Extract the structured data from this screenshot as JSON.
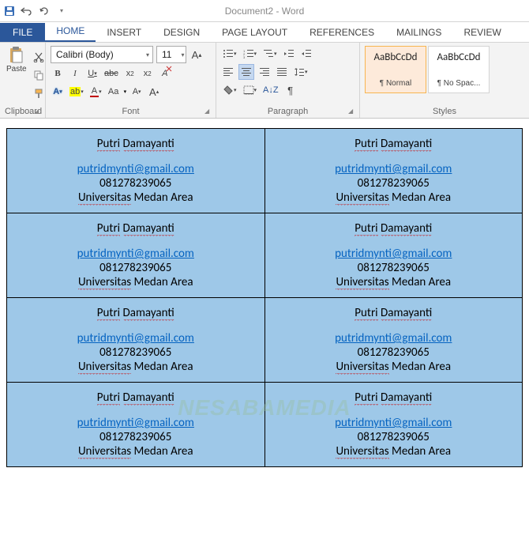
{
  "title": "Document2 - Word",
  "tabs": {
    "file": "FILE",
    "home": "HOME",
    "insert": "INSERT",
    "design": "DESIGN",
    "layout": "PAGE LAYOUT",
    "references": "REFERENCES",
    "mailings": "MAILINGS",
    "review": "REVIEW"
  },
  "ribbon": {
    "clipboard": {
      "label": "Clipboard",
      "paste": "Paste"
    },
    "font": {
      "label": "Font",
      "name": "Calibri (Body)",
      "size": "11",
      "bold": "B",
      "italic": "I",
      "underline": "U",
      "strike": "abc",
      "sub": "x₂",
      "sup": "x²",
      "fontcolor": "A",
      "highlight": "ab",
      "clear": "A",
      "case": "Aa",
      "grow": "A",
      "shrink": "A"
    },
    "paragraph": {
      "label": "Paragraph"
    },
    "styles": {
      "label": "Styles",
      "items": [
        {
          "sample": "AaBbCcDd",
          "name": "¶ Normal"
        },
        {
          "sample": "AaBbCcDd",
          "name": "¶ No Spac..."
        }
      ]
    }
  },
  "watermark": "NESABAMEDIA",
  "label": {
    "name": "Putri Damayanti",
    "name_p1": "Putri",
    "name_p2": "Damayanti",
    "email": "putridmynti@gmail.com",
    "phone": "081278239065",
    "univ": "Universitas Medan Area",
    "univ_p1": "Universitas",
    "univ_p2": "Medan Area"
  }
}
